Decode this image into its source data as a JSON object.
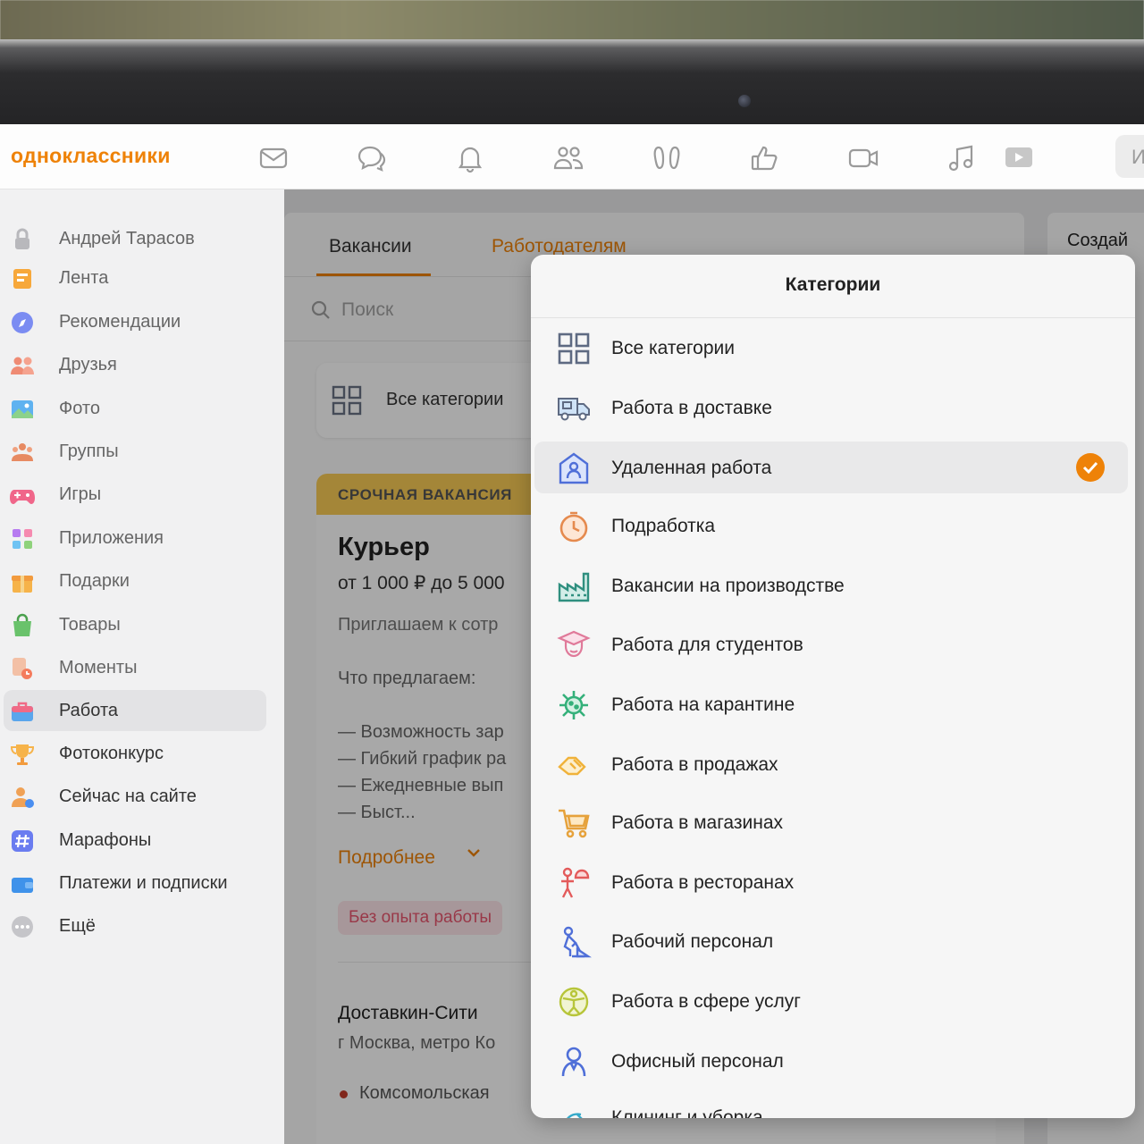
{
  "topnav": {
    "logo": "одноклассники",
    "search_stub": "И",
    "icons": [
      "mail-icon",
      "chat-icon",
      "bell-icon",
      "friends-icon",
      "guests-icon",
      "likes-icon",
      "video-icon",
      "music-icon",
      "games-icon"
    ]
  },
  "sidebar": {
    "items": [
      {
        "label": "Андрей Тарасов",
        "icon": "lock-icon"
      },
      {
        "label": "Лента",
        "icon": "feed-icon"
      },
      {
        "label": "Рекомендации",
        "icon": "compass-icon"
      },
      {
        "label": "Друзья",
        "icon": "friends-icon"
      },
      {
        "label": "Фото",
        "icon": "photo-icon"
      },
      {
        "label": "Группы",
        "icon": "groups-icon"
      },
      {
        "label": "Игры",
        "icon": "gamepad-icon"
      },
      {
        "label": "Приложения",
        "icon": "apps-icon"
      },
      {
        "label": "Подарки",
        "icon": "gift-icon"
      },
      {
        "label": "Товары",
        "icon": "shopping-bag-icon"
      },
      {
        "label": "Моменты",
        "icon": "moments-icon"
      },
      {
        "label": "Работа",
        "icon": "briefcase-icon"
      },
      {
        "label": "Фотоконкурс",
        "icon": "trophy-icon"
      },
      {
        "label": "Сейчас на сайте",
        "icon": "online-icon"
      },
      {
        "label": "Марафоны",
        "icon": "hashtag-icon"
      },
      {
        "label": "Платежи и подписки",
        "icon": "wallet-icon"
      },
      {
        "label": "Ещё",
        "icon": "more-icon"
      }
    ]
  },
  "main": {
    "tabs": [
      {
        "label": "Вакансии"
      },
      {
        "label": "Работодателям"
      }
    ],
    "search": {
      "placeholder": "Поиск"
    },
    "all_categories_button": "Все категории",
    "vacancy": {
      "banner": "СРОЧНАЯ ВАКАНСИЯ",
      "title": "Курьер",
      "salary": "от 1 000 ₽ до 5 000",
      "intro": "Приглашаем к сотр",
      "offer_heading": "Что предлагаем:",
      "lines": [
        "— Возможность зар",
        "— Гибкий график ра",
        "— Ежедневные вып",
        "— Быст..."
      ],
      "more": "Подробнее",
      "tag": "Без опыта работы",
      "company": "Доставкин-Сити",
      "address": "г Москва, метро Ко",
      "metro": "Комсомольская"
    }
  },
  "right_panel": {
    "title": "Создай"
  },
  "dropdown": {
    "title": "Категории",
    "items": [
      {
        "label": "Все категории",
        "icon": "grid-icon",
        "selected": false
      },
      {
        "label": "Работа в доставке",
        "icon": "delivery-truck-icon",
        "selected": false
      },
      {
        "label": "Удаленная работа",
        "icon": "remote-work-icon",
        "selected": true
      },
      {
        "label": "Подработка",
        "icon": "stopwatch-icon",
        "selected": false
      },
      {
        "label": "Вакансии на производстве",
        "icon": "factory-icon",
        "selected": false
      },
      {
        "label": "Работа для студентов",
        "icon": "graduate-icon",
        "selected": false
      },
      {
        "label": "Работа на карантине",
        "icon": "virus-icon",
        "selected": false
      },
      {
        "label": "Работа в продажах",
        "icon": "handshake-icon",
        "selected": false
      },
      {
        "label": "Работа в магазинах",
        "icon": "shopping-cart-icon",
        "selected": false
      },
      {
        "label": "Работа в ресторанах",
        "icon": "waiter-icon",
        "selected": false
      },
      {
        "label": "Рабочий персонал",
        "icon": "worker-icon",
        "selected": false
      },
      {
        "label": "Работа в сфере услуг",
        "icon": "service-icon",
        "selected": false
      },
      {
        "label": "Офисный персонал",
        "icon": "office-person-icon",
        "selected": false
      },
      {
        "label": "Клининг и уборка",
        "icon": "cleaning-icon",
        "selected": false
      }
    ]
  },
  "colors": {
    "accent": "#ee8208",
    "urgent": "#f9cb55",
    "tag_bg": "#fde6ea",
    "tag_text": "#e8556e"
  }
}
